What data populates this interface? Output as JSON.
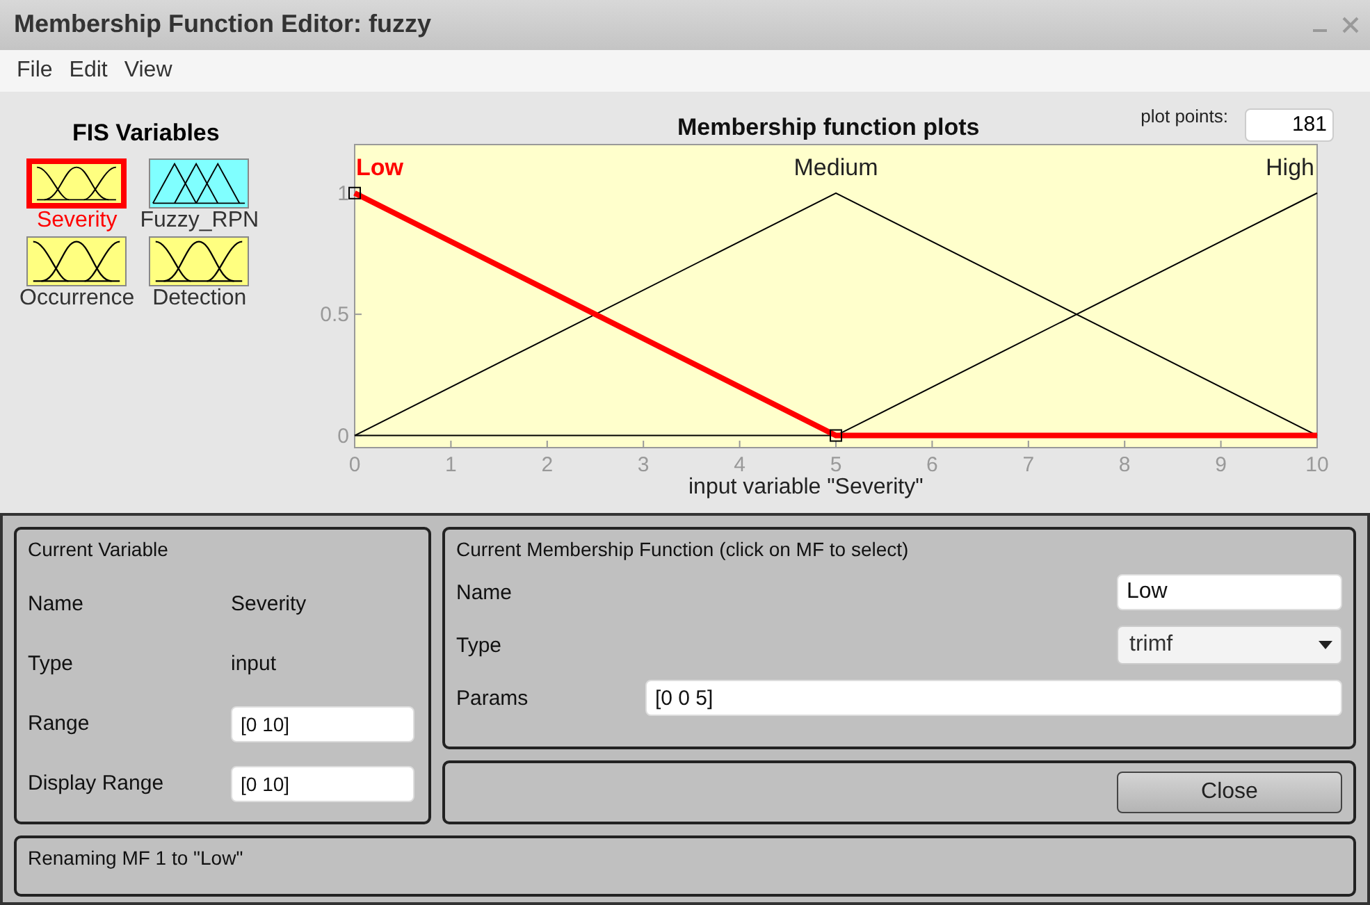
{
  "window": {
    "title": "Membership Function Editor: fuzzy"
  },
  "menu": [
    "File",
    "Edit",
    "View"
  ],
  "fis_variables": {
    "title": "FIS Variables",
    "items": [
      {
        "name": "Severity",
        "kind": "input",
        "selected": true
      },
      {
        "name": "Fuzzy_RPN",
        "kind": "output",
        "selected": false
      },
      {
        "name": "Occurrence",
        "kind": "input",
        "selected": false
      },
      {
        "name": "Detection",
        "kind": "input",
        "selected": false
      }
    ]
  },
  "plot_points": {
    "label": "plot points:",
    "value": "181"
  },
  "plot": {
    "mf_selected": [
      true,
      false,
      false
    ],
    "chart_data": {
      "type": "line",
      "title": "Membership function plots",
      "xlabel": "input variable \"Severity\"",
      "x": [
        0,
        5,
        10
      ],
      "xlim": [
        0,
        10
      ],
      "ylim": [
        -0.05,
        1.2
      ],
      "xticks": [
        0,
        1,
        2,
        3,
        4,
        5,
        6,
        7,
        8,
        9,
        10
      ],
      "yticks": [
        0,
        0.5,
        1
      ],
      "series": [
        {
          "name": "Low",
          "color": "#ff0000",
          "values": [
            1,
            0,
            0
          ]
        },
        {
          "name": "Medium",
          "color": "#000000",
          "values": [
            0,
            1,
            0
          ]
        },
        {
          "name": "High",
          "color": "#000000",
          "values": [
            0,
            0,
            1
          ]
        }
      ]
    }
  },
  "current_variable": {
    "title": "Current Variable",
    "rows": [
      {
        "label": "Name",
        "value": "Severity",
        "kind": "text"
      },
      {
        "label": "Type",
        "value": "input",
        "kind": "text"
      },
      {
        "label": "Range",
        "value": "[0 10]",
        "kind": "field"
      },
      {
        "label": "Display Range",
        "value": "[0 10]",
        "kind": "field"
      }
    ]
  },
  "current_mf": {
    "title": "Current Membership Function (click on MF to select)",
    "name_label": "Name",
    "name_value": "Low",
    "type_label": "Type",
    "type_value": "trimf",
    "params_label": "Params",
    "params_value": "[0 0 5]"
  },
  "close_button": "Close",
  "status": "Renaming MF 1 to \"Low\""
}
